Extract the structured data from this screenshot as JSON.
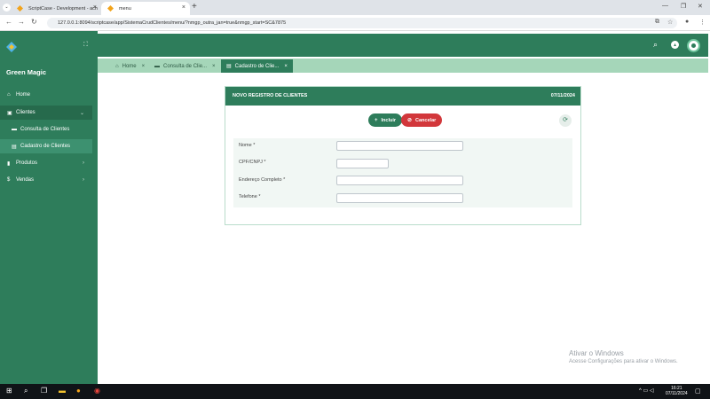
{
  "browser": {
    "tabs": [
      {
        "title": "ScriptCase - Development - ach"
      },
      {
        "title": "menu"
      }
    ],
    "url": "127.0.0.1:8094/scriptcase/app/SistemaCrudClientes/menu/?nmgp_outra_jan=true&nmgp_start=SC&7875"
  },
  "app": {
    "brand": "Green Magic",
    "sidebar": {
      "items": [
        {
          "label": "Home"
        },
        {
          "label": "Clientes"
        },
        {
          "label": "Consulta de Clientes"
        },
        {
          "label": "Cadastro de Clientes"
        },
        {
          "label": "Produtos"
        },
        {
          "label": "Vendas"
        }
      ]
    },
    "tabs": [
      {
        "label": "Home"
      },
      {
        "label": "Consulta de Clie..."
      },
      {
        "label": "Cadastro de Clie..."
      }
    ],
    "form": {
      "title": "NOVO REGISTRO DE CLIENTES",
      "date": "07/11/2024",
      "incluir_label": "Incluir",
      "cancelar_label": "Cancelar",
      "fields": [
        {
          "label": "Nome *",
          "value": ""
        },
        {
          "label": "CPF/CNPJ *",
          "value": ""
        },
        {
          "label": "Endereço Completo *",
          "value": ""
        },
        {
          "label": "Telefone *",
          "value": ""
        }
      ]
    }
  },
  "watermark": {
    "line1": "Ativar o Windows",
    "line2": "Acesse Configurações para ativar o Windows."
  },
  "taskbar": {
    "time": "16:21",
    "date": "07/11/2024"
  },
  "colors": {
    "primary": "#2e7d5b",
    "tabs_bar": "#a5d6b9",
    "danger": "#d2373b"
  }
}
